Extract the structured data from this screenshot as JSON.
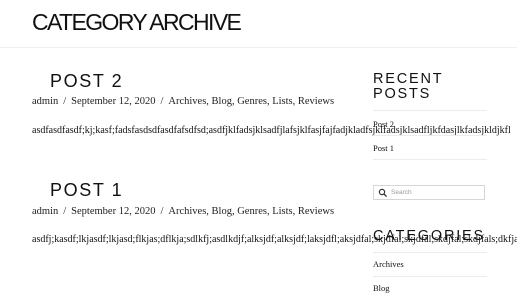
{
  "header": {
    "title": "CATEGORY ARCHIVE"
  },
  "posts": [
    {
      "title": "POST 2",
      "author": "admin",
      "date": "September 12, 2020",
      "categories": [
        "Archives",
        "Blog",
        "Genres",
        "Lists",
        "Reviews"
      ],
      "excerpt": "asdfasdfasdf;kj;kasf;fadsfasdsdfasdfafsdfsd;asdfjklfadsjklsadfjlafsjklfasjfajfadjkladfsjklfadsjklsadfljkfdasjlkfadsjkldjkfl"
    },
    {
      "title": "POST 1",
      "author": "admin",
      "date": "September 12, 2020",
      "categories": [
        "Archives",
        "Blog",
        "Genres",
        "Lists",
        "Reviews"
      ],
      "excerpt": "asdfj;kasdf;lkjasdf;lkjasd;flkjas;dflkja;sdlkfj;asdlkdjf;alksjdf;alksjdf;laksjdfl;aksjdfal;skjdfal;skjdfal;skdjfal;skdjfals;dkfjal"
    }
  ],
  "sidebar": {
    "recent_posts_title": "RECENT POSTS",
    "recent_posts": [
      "Post 2",
      "Post 1"
    ],
    "search_placeholder": "Search",
    "categories_title": "CATEGORIES",
    "categories": [
      "Archives",
      "Blog"
    ]
  },
  "meta_separator": "/"
}
